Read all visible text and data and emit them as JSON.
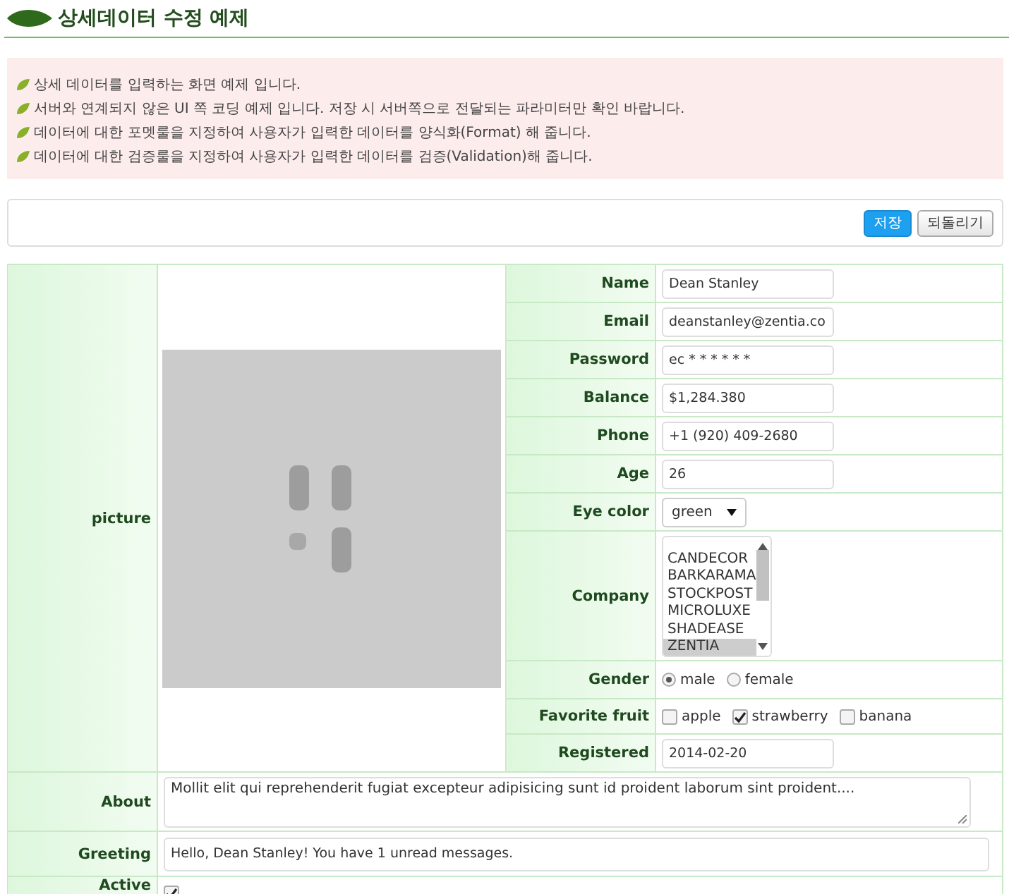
{
  "title": "상세데이터 수정 예제",
  "notices": [
    "상세 데이터를 입력하는 화면 예제 입니다.",
    "서버와 연계되지 않은 UI 쪽 코딩 예제 입니다. 저장 시 서버쪽으로 전달되는 파라미터만 확인 바랍니다.",
    "데이터에 대한 포멧룰을 지정하여 사용자가 입력한 데이터를 양식화(Format) 해 줍니다.",
    "데이터에 대한 검증룰을 지정하여 사용자가 입력한 데이터를 검증(Validation)해 줍니다."
  ],
  "toolbar": [
    {
      "label": "저장",
      "kind": "primary"
    },
    {
      "label": "되돌리기",
      "kind": "default"
    }
  ],
  "picture": {
    "label": "picture",
    "kind": "picture"
  },
  "fields": [
    {
      "label": "Name",
      "kind": "text",
      "value": "Dean Stanley"
    },
    {
      "label": "Email",
      "kind": "text",
      "value": "deanstanley@zentia.co"
    },
    {
      "label": "Password",
      "kind": "text",
      "value": "ec * * * * * *"
    },
    {
      "label": "Balance",
      "kind": "text",
      "value": "$1,284.380"
    },
    {
      "label": "Phone",
      "kind": "text",
      "value": "+1 (920) 409-2680"
    },
    {
      "label": "Age",
      "kind": "text",
      "value": "26"
    },
    {
      "label": "Eye color",
      "kind": "select",
      "value": "green"
    },
    {
      "label": "Company",
      "kind": "listbox",
      "options": [
        {
          "label": "CANDECOR",
          "selected": false
        },
        {
          "label": "BARKARAMA",
          "selected": false
        },
        {
          "label": "STOCKPOST",
          "selected": false
        },
        {
          "label": "MICROLUXE",
          "selected": false
        },
        {
          "label": "SHADEASE",
          "selected": false
        },
        {
          "label": "ZENTIA",
          "selected": true
        }
      ]
    },
    {
      "label": "Gender",
      "kind": "radio",
      "options": [
        {
          "label": "male",
          "selected": true
        },
        {
          "label": "female",
          "selected": false
        }
      ]
    },
    {
      "label": "Favorite fruit",
      "kind": "checkbox",
      "options": [
        {
          "label": "apple",
          "checked": false
        },
        {
          "label": "strawberry",
          "checked": true
        },
        {
          "label": "banana",
          "checked": false
        }
      ]
    },
    {
      "label": "Registered",
      "kind": "text",
      "value": "2014-02-20"
    }
  ],
  "about": {
    "label": "About",
    "value": "Mollit elit qui reprehenderit fugiat excepteur adipisicing sunt id proident laborum sint proident...."
  },
  "greeting": {
    "label": "Greeting",
    "value": "Hello, Dean Stanley! You have 1 unread messages."
  },
  "active": {
    "label": "Active",
    "checked": true
  }
}
